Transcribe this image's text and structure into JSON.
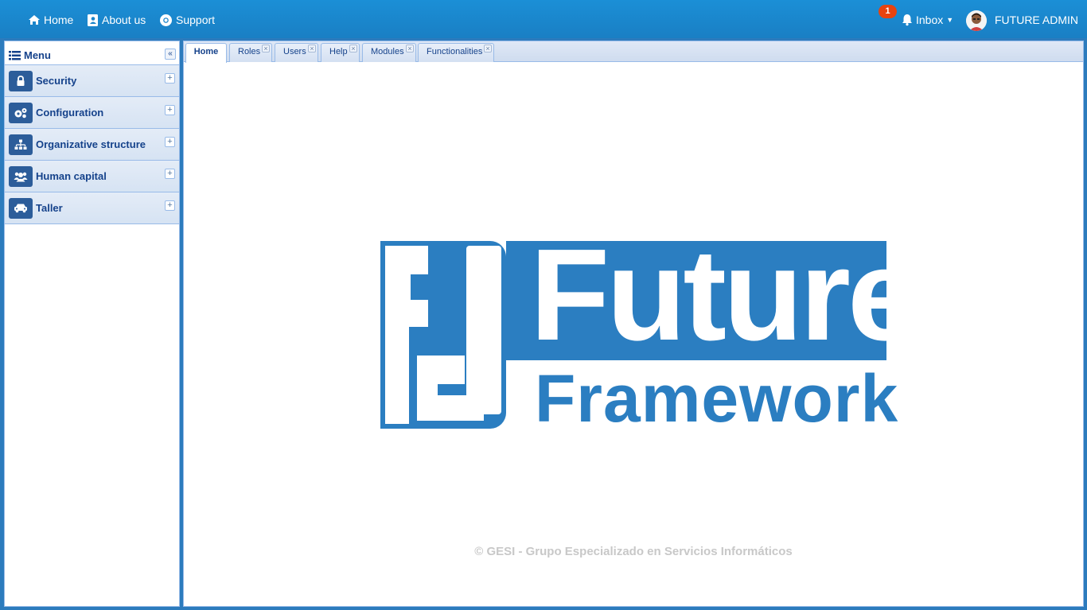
{
  "topbar": {
    "nav": [
      {
        "label": "Home",
        "icon": "home-icon"
      },
      {
        "label": "About us",
        "icon": "contact-card-icon"
      },
      {
        "label": "Support",
        "icon": "lifebuoy-icon"
      }
    ],
    "notification_count": "1",
    "inbox_label": "Inbox",
    "user_name": "FUTURE ADMIN"
  },
  "sidebar": {
    "title": "Menu",
    "items": [
      {
        "label": "Security",
        "icon": "lock-icon"
      },
      {
        "label": "Configuration",
        "icon": "gears-icon"
      },
      {
        "label": "Organizative structure",
        "icon": "sitemap-icon"
      },
      {
        "label": "Human capital",
        "icon": "users-icon"
      },
      {
        "label": "Taller",
        "icon": "car-icon"
      }
    ]
  },
  "tabs": [
    {
      "label": "Home",
      "active": true,
      "closable": false
    },
    {
      "label": "Roles",
      "active": false,
      "closable": true
    },
    {
      "label": "Users",
      "active": false,
      "closable": true
    },
    {
      "label": "Help",
      "active": false,
      "closable": true
    },
    {
      "label": "Modules",
      "active": false,
      "closable": true
    },
    {
      "label": "Functionalities",
      "active": false,
      "closable": true
    }
  ],
  "logo": {
    "line1": "Future",
    "line2": "Framework",
    "color": "#2b7ec1"
  },
  "footer": "© GESI - Grupo Especializado en Servicios Informáticos",
  "colors": {
    "topbar": "#1a86cc",
    "frame": "#2c7bbd",
    "accent": "#15428b",
    "badge": "#e8430f"
  }
}
